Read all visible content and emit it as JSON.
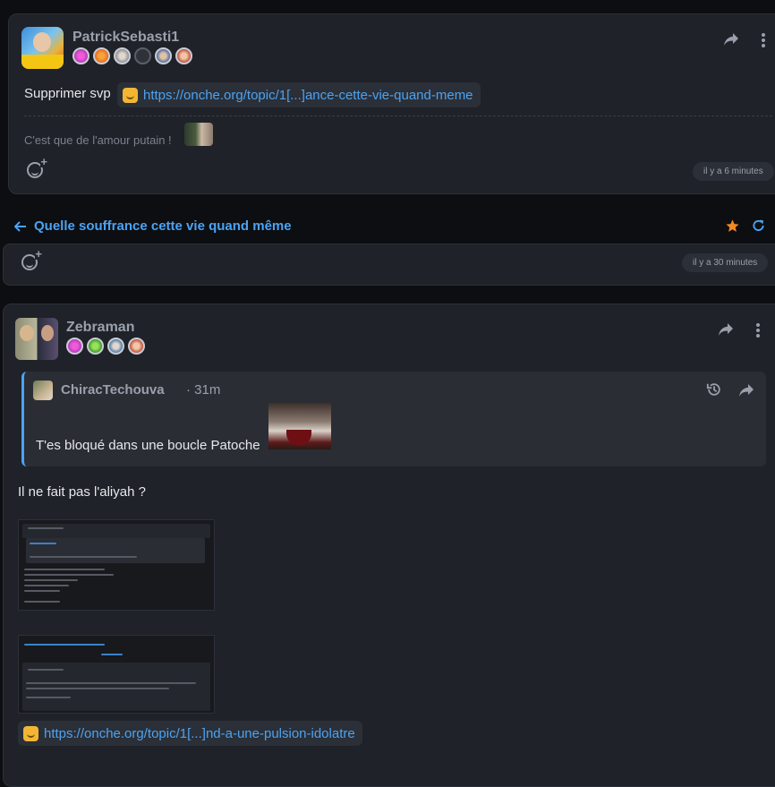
{
  "post1": {
    "username": "PatrickSebasti1",
    "message": "Supprimer svp",
    "link": "https://onche.org/topic/1[...]ance-cette-vie-quand-meme",
    "signature": "C'est que de l'amour putain !",
    "time": "il y a 6 minutes"
  },
  "topic": {
    "title": "Quelle souffrance cette vie quand même",
    "time": "il y a 30 minutes"
  },
  "post2": {
    "username": "Zebraman",
    "quote": {
      "username": "ChiracTechouva",
      "time": "· 31m",
      "text": "T'es bloqué dans une boucle Patoche"
    },
    "message": "Il ne fait pas l'aliyah ?",
    "link": "https://onche.org/topic/1[...]nd-a-une-pulsion-idolatre"
  },
  "colors": {
    "accent": "#4ba3f3",
    "star": "#f08a24",
    "background": "#0d0e11",
    "card": "#1f2228"
  },
  "icons": [
    "share-icon",
    "more-vertical-icon",
    "add-reaction-icon",
    "back-arrow-icon",
    "star-icon",
    "refresh-icon",
    "history-icon"
  ]
}
